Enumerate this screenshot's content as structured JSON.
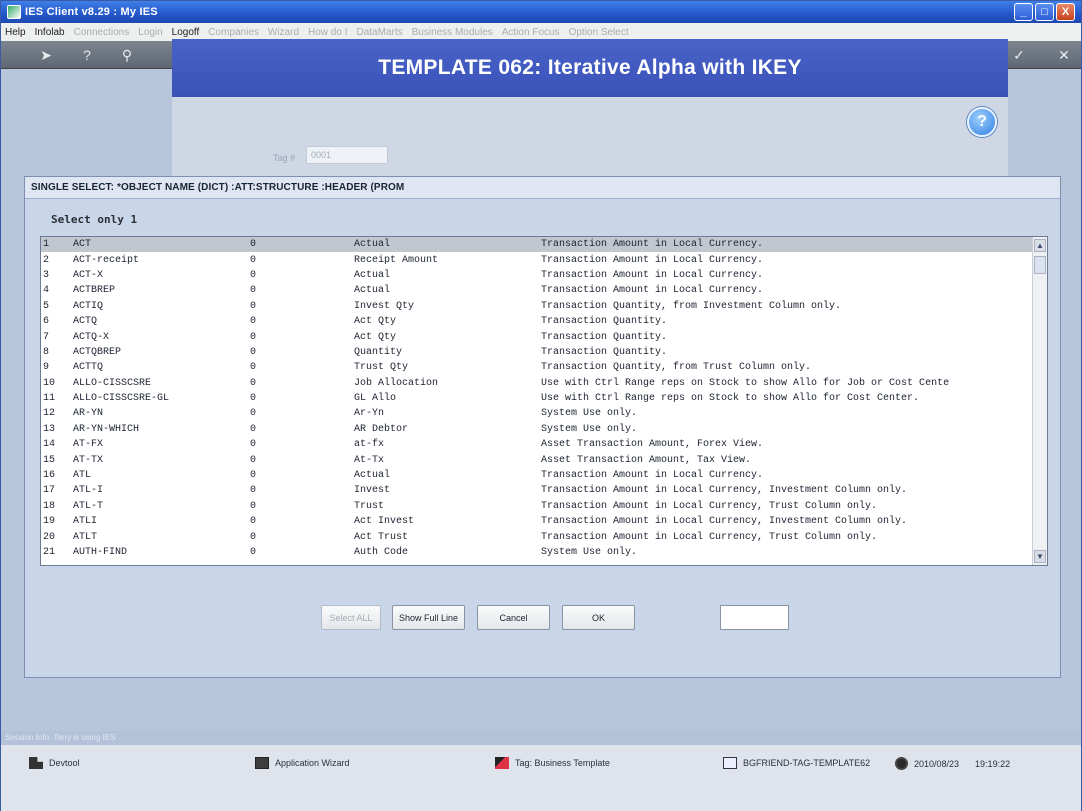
{
  "window": {
    "title": "IES Client v8.29 : My IES",
    "buttons": [
      "_",
      "□",
      "X"
    ]
  },
  "menu": [
    {
      "label": "Help",
      "enabled": true
    },
    {
      "label": "Infolab",
      "enabled": true
    },
    {
      "label": "Connections",
      "enabled": false
    },
    {
      "label": "Login",
      "enabled": false
    },
    {
      "label": "Logoff",
      "enabled": true
    },
    {
      "label": "Companies",
      "enabled": false
    },
    {
      "label": "Wizard",
      "enabled": false
    },
    {
      "label": "How do I",
      "enabled": false
    },
    {
      "label": "DataMarts",
      "enabled": false
    },
    {
      "label": "Business Modules",
      "enabled": false
    },
    {
      "label": "Action Focus",
      "enabled": false
    },
    {
      "label": "Option Select",
      "enabled": false
    }
  ],
  "toolbar_icons": [
    "arrow-icon",
    "help-icon",
    "search-icon",
    "heart-icon",
    "refresh-icon",
    "back-icon",
    "forward-icon",
    "up-icon",
    "settings-icon",
    "check-icon",
    "close-icon"
  ],
  "banner": {
    "title": "TEMPLATE 062: Iterative  Alpha with IKEY"
  },
  "background_field": {
    "label": "Tag #",
    "value": "0001"
  },
  "help_button": {
    "label": "?"
  },
  "dialog": {
    "title": "SINGLE SELECT: *OBJECT NAME (DICT)  :ATT:STRUCTURE  :HEADER (PROM",
    "select_label": "Select only 1",
    "rows": [
      {
        "idx": "1",
        "name": "ACT",
        "flag": "0",
        "desc": "Actual",
        "long": "Transaction Amount in Local Currency."
      },
      {
        "idx": "2",
        "name": "ACT-receipt",
        "flag": "0",
        "desc": "Receipt Amount",
        "long": "Transaction Amount in Local Currency."
      },
      {
        "idx": "3",
        "name": "ACT-X",
        "flag": "0",
        "desc": "Actual",
        "long": "Transaction Amount in Local Currency."
      },
      {
        "idx": "4",
        "name": "ACTBREP",
        "flag": "0",
        "desc": "Actual",
        "long": "Transaction Amount in Local Currency."
      },
      {
        "idx": "5",
        "name": "ACTIQ",
        "flag": "0",
        "desc": "Invest Qty",
        "long": "Transaction Quantity, from Investment Column only."
      },
      {
        "idx": "6",
        "name": "ACTQ",
        "flag": "0",
        "desc": "Act Qty",
        "long": "Transaction Quantity."
      },
      {
        "idx": "7",
        "name": "ACTQ-X",
        "flag": "0",
        "desc": "Act Qty",
        "long": "Transaction Quantity."
      },
      {
        "idx": "8",
        "name": "ACTQBREP",
        "flag": "0",
        "desc": "Quantity",
        "long": "Transaction Quantity."
      },
      {
        "idx": "9",
        "name": "ACTTQ",
        "flag": "0",
        "desc": "Trust Qty",
        "long": "Transaction Quantity, from Trust Column only."
      },
      {
        "idx": "10",
        "name": "ALLO-CISSCSRE",
        "flag": "0",
        "desc": "Job Allocation",
        "long": "Use with Ctrl Range reps on Stock to show Allo for Job or Cost Cente"
      },
      {
        "idx": "11",
        "name": "ALLO-CISSCSRE-GL",
        "flag": "0",
        "desc": "GL Allo",
        "long": "Use with Ctrl Range reps on Stock to show Allo for Cost Center."
      },
      {
        "idx": "12",
        "name": "AR-YN",
        "flag": "0",
        "desc": "Ar-Yn",
        "long": "System Use only."
      },
      {
        "idx": "13",
        "name": "AR-YN-WHICH",
        "flag": "0",
        "desc": "AR Debtor",
        "long": "System Use only."
      },
      {
        "idx": "14",
        "name": "AT-FX",
        "flag": "0",
        "desc": "at-fx",
        "long": "Asset Transaction Amount, Forex View."
      },
      {
        "idx": "15",
        "name": "AT-TX",
        "flag": "0",
        "desc": "At-Tx",
        "long": "Asset Transaction Amount, Tax View."
      },
      {
        "idx": "16",
        "name": "ATL",
        "flag": "0",
        "desc": "Actual",
        "long": "Transaction Amount in Local Currency."
      },
      {
        "idx": "17",
        "name": "ATL-I",
        "flag": "0",
        "desc": "Invest",
        "long": "Transaction Amount in Local Currency, Investment Column only."
      },
      {
        "idx": "18",
        "name": "ATL-T",
        "flag": "0",
        "desc": "Trust",
        "long": "Transaction Amount in Local Currency, Trust Column only."
      },
      {
        "idx": "19",
        "name": "ATLI",
        "flag": "0",
        "desc": "Act Invest",
        "long": "Transaction Amount in Local Currency, Investment Column only."
      },
      {
        "idx": "20",
        "name": "ATLT",
        "flag": "0",
        "desc": "Act Trust",
        "long": "Transaction Amount in Local Currency, Trust Column only."
      },
      {
        "idx": "21",
        "name": "AUTH-FIND",
        "flag": "0",
        "desc": "Auth Code",
        "long": "System Use only."
      }
    ],
    "buttons": {
      "select_all": "Select ALL",
      "show_full_line": "Show Full Line",
      "cancel": "Cancel",
      "ok": "OK"
    },
    "input_value": ""
  },
  "session_info": "Session Info: Terry is using IES",
  "statusbar": [
    {
      "icon": "devtool-icon",
      "label": "Devtool"
    },
    {
      "icon": "wizard-icon",
      "label": "Application Wizard"
    },
    {
      "icon": "tag-icon",
      "label": "Tag: Business Template"
    },
    {
      "icon": "template-icon",
      "label": "BGFRIEND-TAG-TEMPLATE62"
    },
    {
      "icon": "clock-icon",
      "label": "2010/08/23"
    },
    {
      "icon": "",
      "label": "19:19:22"
    }
  ],
  "colors": {
    "titlebar": "#2457c8",
    "banner": "#4a63c9",
    "workspace": "#b8c6dd",
    "dialog": "#c9d6ea",
    "selected_row": "#c2c7cf"
  }
}
